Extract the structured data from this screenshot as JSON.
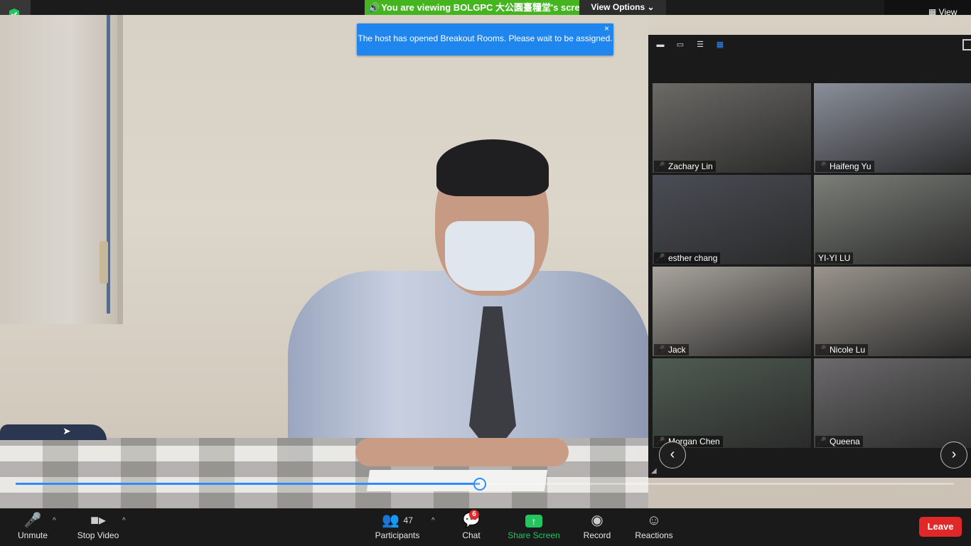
{
  "banner": {
    "sharing_text": "You are viewing BOLGPC 大公園臺糧堂's screen",
    "view_options": "View Options"
  },
  "window": {
    "view_label": "View"
  },
  "notification": {
    "text": "The host has opened Breakout Rooms. Please wait to be assigned.",
    "close": "×"
  },
  "progress": {
    "value": 0.495
  },
  "gallery": {
    "tiles": [
      {
        "name": "Zachary Lin",
        "bg": "#6b6a66"
      },
      {
        "name": "Haifeng Yu",
        "bg": "#8a8f9a"
      },
      {
        "name": "esther chang",
        "bg": "#4a4d55"
      },
      {
        "name": "YI-YI LU",
        "bg": "#7b7f78"
      },
      {
        "name": "Jack",
        "bg": "#a9a49d"
      },
      {
        "name": "Nicole Lu",
        "bg": "#9a958d"
      },
      {
        "name": "Morgan Chen",
        "bg": "#4f5c52"
      },
      {
        "name": "Queena",
        "bg": "#6c6a6c"
      }
    ],
    "prev": "‹",
    "next": "›"
  },
  "toolbar": {
    "unmute": "Unmute",
    "stop_video": "Stop Video",
    "participants": "Participants",
    "participants_count": "47",
    "chat": "Chat",
    "chat_badge": "6",
    "share_screen": "Share Screen",
    "record": "Record",
    "reactions": "Reactions",
    "leave": "Leave"
  },
  "colors": {
    "accent": "#2d8cff",
    "share_green": "#45b51f",
    "leave_red": "#e02828",
    "notice_blue": "#1f86ef"
  }
}
